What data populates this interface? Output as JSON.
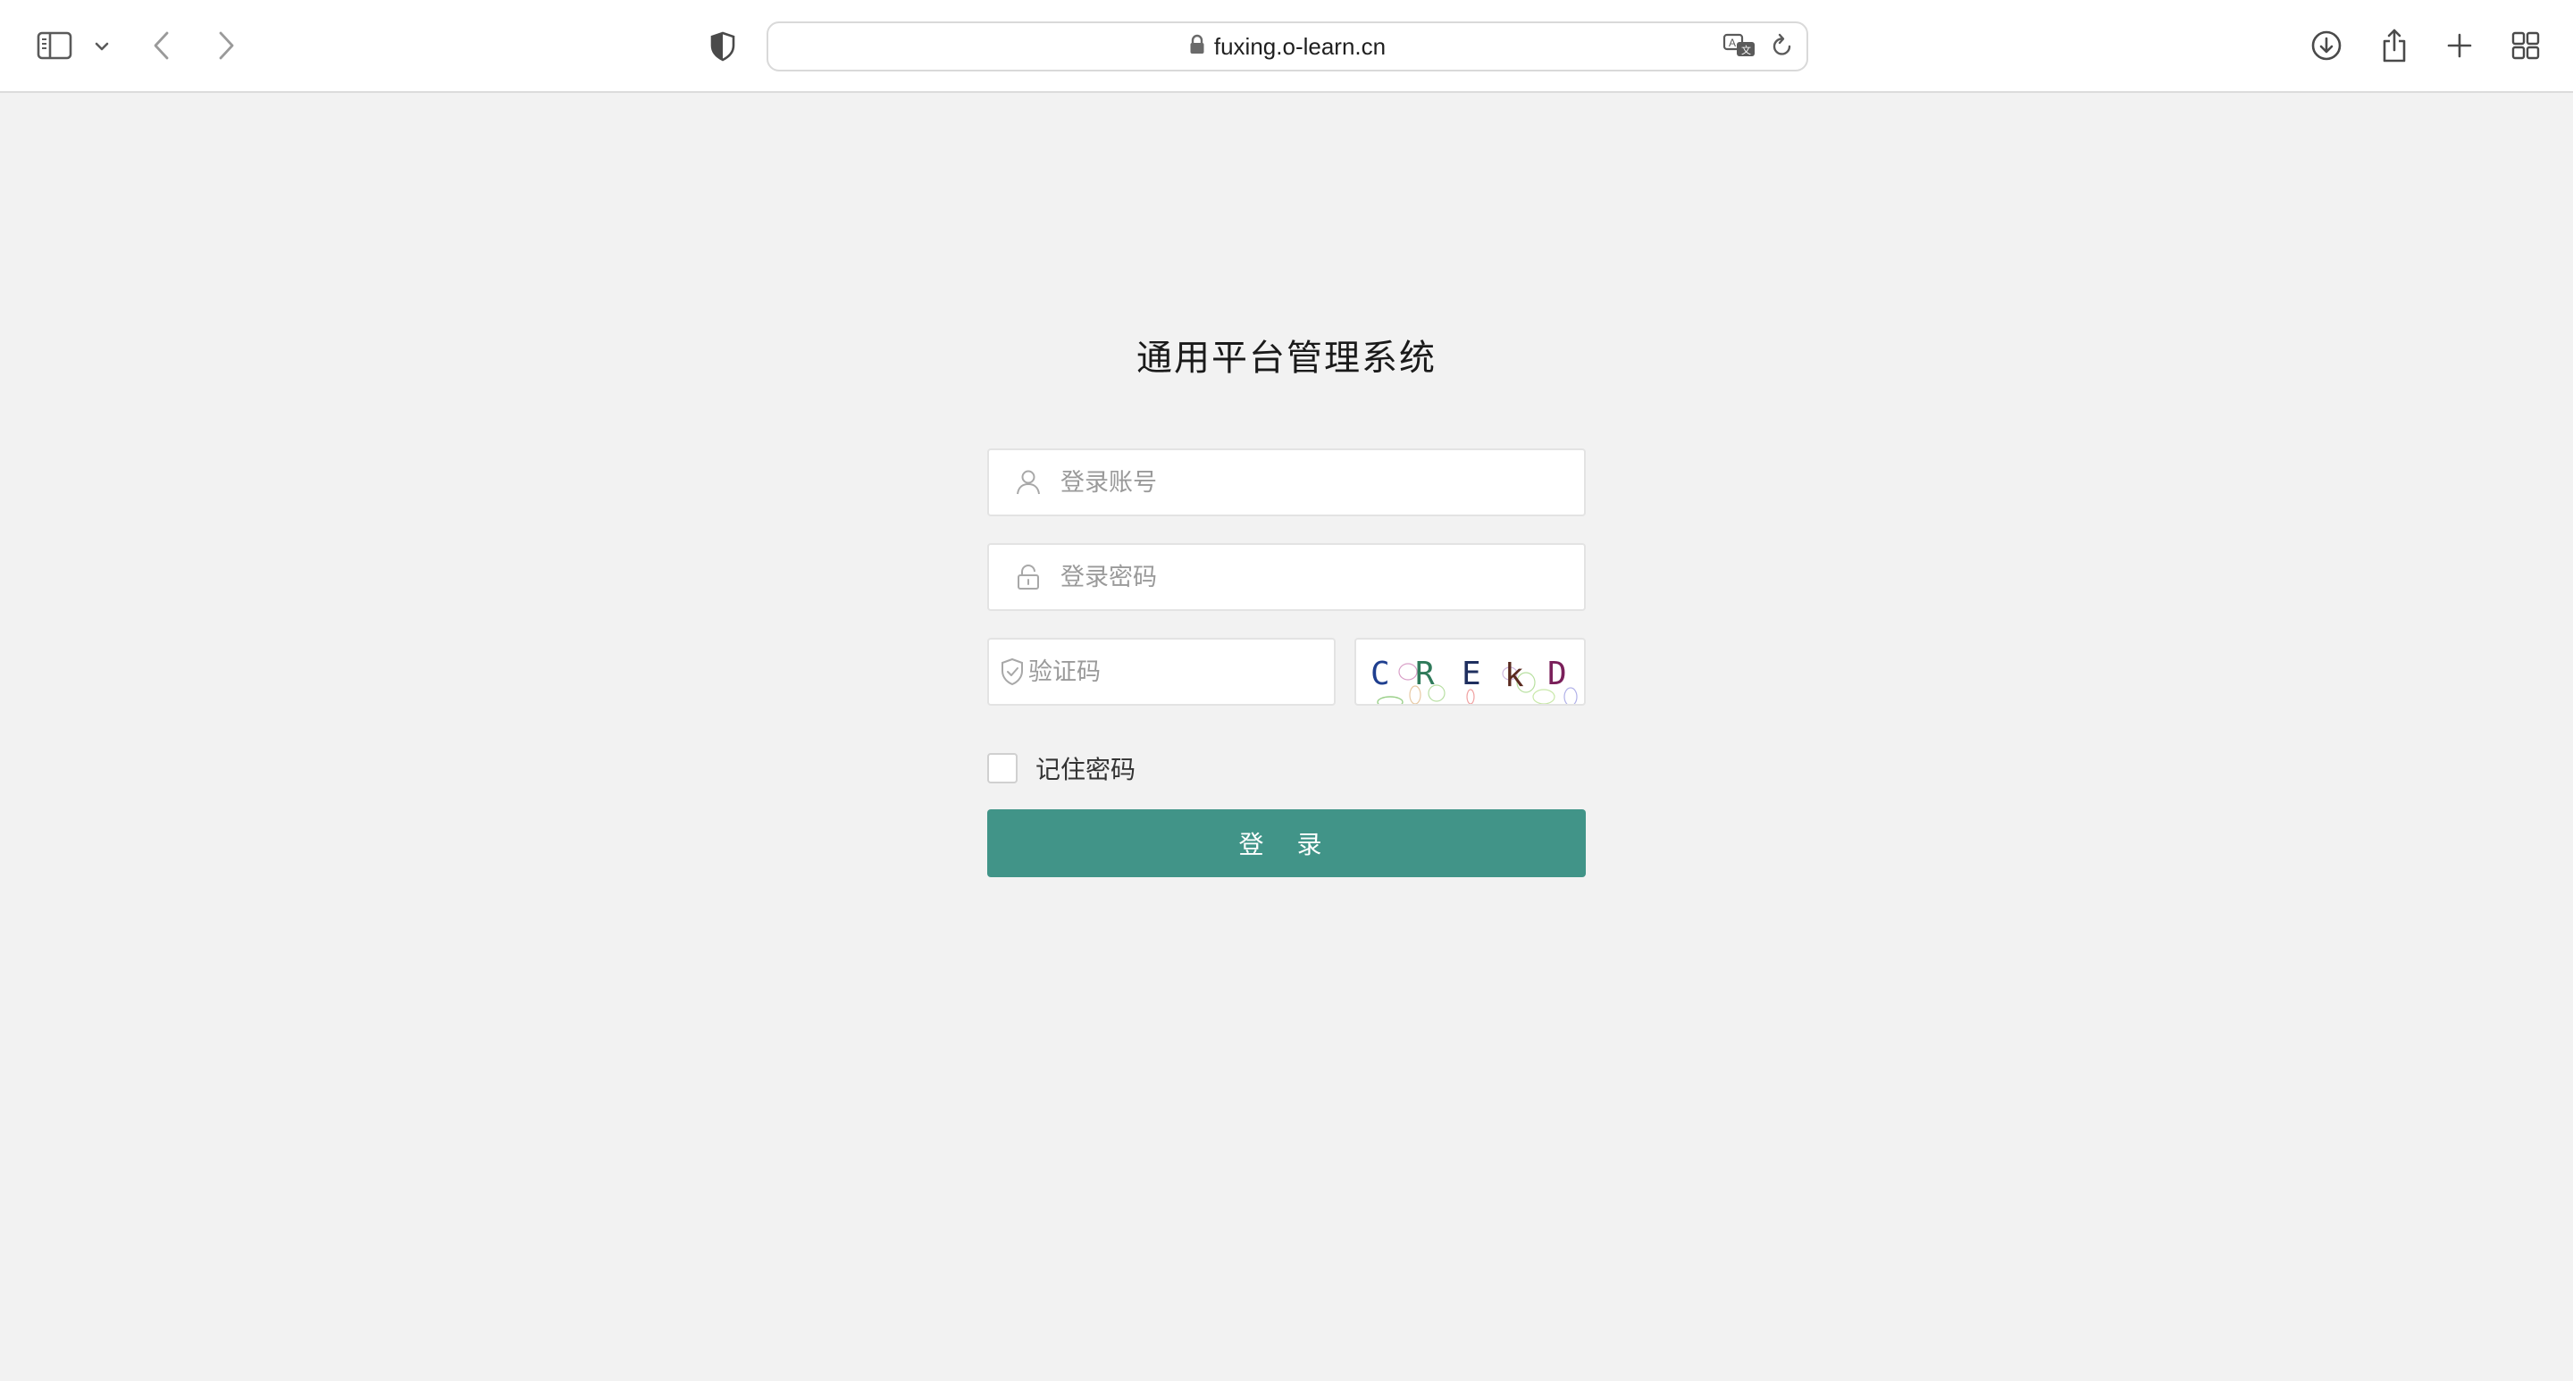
{
  "browser": {
    "url": "fuxing.o-learn.cn",
    "icons": {
      "sidebar": "sidebar-icon",
      "sidebar_menu": "chevron-down-icon",
      "back": "chevron-left-icon",
      "forward": "chevron-right-icon",
      "privacy": "shield-half-icon",
      "lock": "lock-icon",
      "translate": "translate-icon",
      "reload": "reload-icon",
      "download": "download-icon",
      "share": "share-icon",
      "new_tab": "plus-icon",
      "tab_overview": "grid-icon"
    }
  },
  "login": {
    "title": "通用平台管理系统",
    "username_placeholder": "登录账号",
    "password_placeholder": "登录密码",
    "captcha_placeholder": "验证码",
    "captcha_text": [
      "C",
      "R",
      "E",
      "k",
      "D"
    ],
    "remember_label": "记住密码",
    "remember_checked": false,
    "submit_label": "登 录"
  },
  "colors": {
    "primary": "#419488",
    "background": "#f2f2f2"
  }
}
